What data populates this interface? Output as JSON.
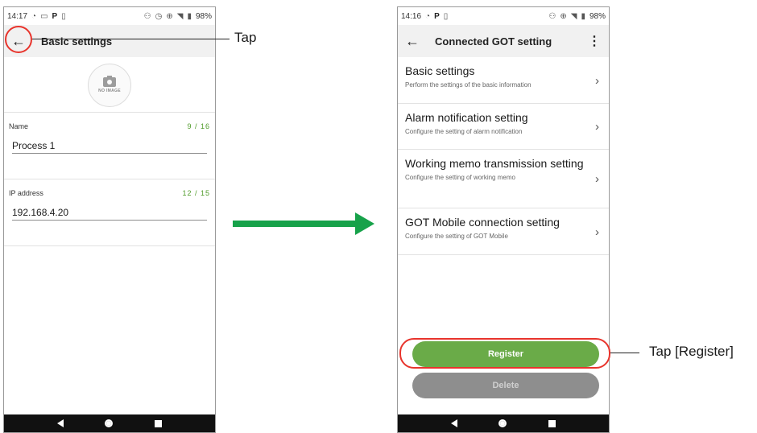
{
  "left_screen": {
    "status": {
      "time": "14:17",
      "battery": "98%"
    },
    "title": "Basic settings",
    "avatar_text": "NO IMAGE",
    "fields": [
      {
        "label": "Name",
        "counter": "9 / 16",
        "value": "Process 1"
      },
      {
        "label": "IP address",
        "counter": "12 / 15",
        "value": "192.168.4.20"
      }
    ]
  },
  "right_screen": {
    "status": {
      "time": "14:16",
      "battery": "98%"
    },
    "title": "Connected GOT setting",
    "menu": [
      {
        "title": "Basic settings",
        "subtitle": "Perform the settings of the basic information"
      },
      {
        "title": "Alarm notification setting",
        "subtitle": "Configure the setting of alarm notification"
      },
      {
        "title": "Working memo transmission setting",
        "subtitle": "Configure the setting of working memo"
      },
      {
        "title": "GOT Mobile connection setting",
        "subtitle": "Configure the setting of GOT Mobile"
      }
    ],
    "register_label": "Register",
    "delete_label": "Delete"
  },
  "annotations": {
    "tap": "Tap",
    "tap_register": "Tap [Register]"
  },
  "colors": {
    "register": "#6aab48",
    "delete": "#8e8e8e",
    "highlight": "#e8342c",
    "flow_arrow": "#17a24a",
    "counter": "#4e9a28"
  },
  "icons": [
    "wifi-icon",
    "parking-icon",
    "sim-icon",
    "alarm-icon",
    "vibrate-icon",
    "signal-icon",
    "battery-icon",
    "back-arrow-icon",
    "more-vert-icon",
    "chevron-right-icon",
    "camera-icon",
    "nav-back-icon",
    "nav-home-icon",
    "nav-recent-icon"
  ]
}
